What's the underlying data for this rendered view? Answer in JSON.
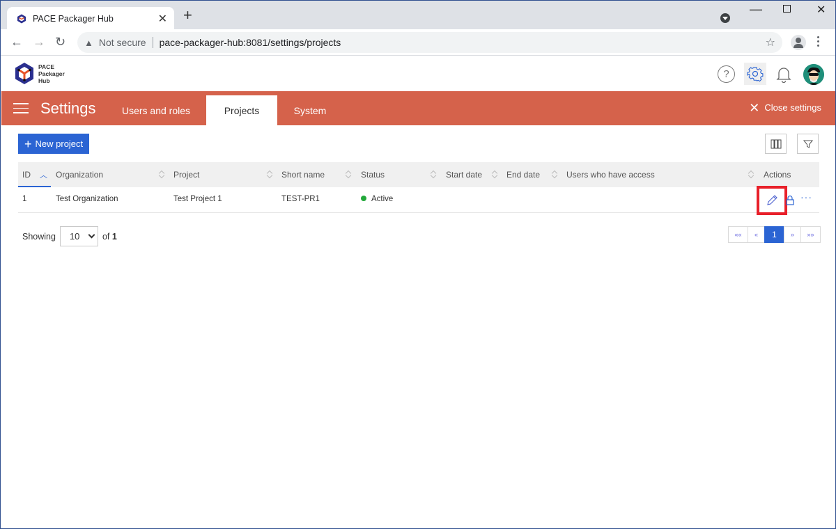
{
  "browser": {
    "tab_title": "PACE Packager Hub",
    "not_secure_label": "Not secure",
    "url": "pace-packager-hub:8081/settings/projects"
  },
  "app": {
    "logo_lines": [
      "PACE",
      "Packager",
      "Hub"
    ],
    "help_glyph": "?"
  },
  "settings_bar": {
    "title": "Settings",
    "tabs": [
      {
        "label": "Users and roles",
        "active": false
      },
      {
        "label": "Projects",
        "active": true
      },
      {
        "label": "System",
        "active": false
      }
    ],
    "close_label": "Close settings"
  },
  "toolbar": {
    "new_project_label": "New project"
  },
  "table": {
    "columns": [
      "ID",
      "Organization",
      "Project",
      "Short name",
      "Status",
      "Start date",
      "End date",
      "Users who have access",
      "Actions"
    ],
    "sort": {
      "column": "ID",
      "direction": "ascending"
    },
    "rows": [
      {
        "id": "1",
        "organization": "Test Organization",
        "project": "Test Project 1",
        "short_name": "TEST-PR1",
        "status": "Active",
        "status_color": "#22a83a",
        "start_date": "",
        "end_date": "",
        "users": ""
      }
    ]
  },
  "pagination": {
    "showing_label": "Showing",
    "page_size": "10",
    "of_label": "of",
    "total_pages": "1",
    "first_label": "««",
    "prev_label": "«",
    "current_page": "1",
    "next_label": "»",
    "last_label": "»»"
  },
  "colors": {
    "accent": "#2b64d3",
    "settings_bar": "#d5624b",
    "highlight": "#e8202a"
  }
}
